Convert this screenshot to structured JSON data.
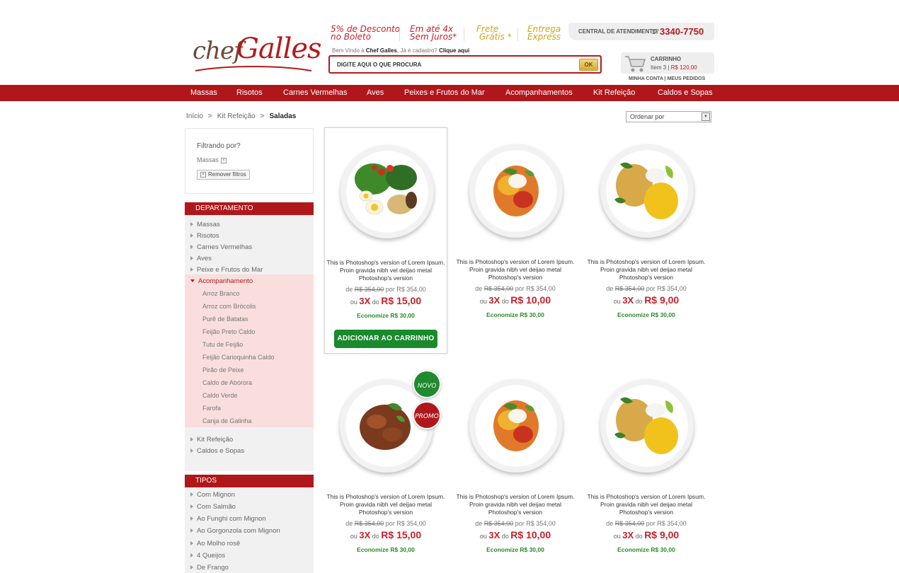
{
  "brand": {
    "chef": "chef",
    "galles": "Galles"
  },
  "promos": [
    {
      "l1": "5% de Desconto",
      "l2": "no Boleto"
    },
    {
      "l1": "Em até 4x",
      "l2": "Sem Juros*"
    },
    {
      "l1": "Frete",
      "l2": "Grátis *"
    },
    {
      "l1": "Entrega",
      "l2": "Express"
    }
  ],
  "atendimento": {
    "label": "CENTRAL DE ATENDIMENTO",
    "ddd": "27",
    "phone": "3340-7750"
  },
  "welcome": {
    "text": "Bem Vindo à ",
    "brand": "Chef Galles",
    "mid": ", Já é cadastro? ",
    "link": "Clique aqui"
  },
  "search": {
    "placeholder": "DIGITE AQUI O QUE PROCURA",
    "button": "OK"
  },
  "cart": {
    "label": "CARRINHO",
    "items": "Item 3",
    "sep": " | ",
    "total": "R$ 120,00"
  },
  "account": {
    "minha_conta": "MINHA CONTA",
    "sep": " | ",
    "meus_pedidos": "MEUS PEDIDOS"
  },
  "nav": [
    "Massas",
    "Risotos",
    "Carnes Vermelhas",
    "Aves",
    "Peixes e Frutos do Mar",
    "Acompanhamentos",
    "Kit Refeição",
    "Caldos e Sopas"
  ],
  "breadcrumb": {
    "home": "Início",
    "sep": ">",
    "parent": "Kit Refeição",
    "current": "Saladas"
  },
  "sort": {
    "selected": "Ordenar por"
  },
  "filter": {
    "title": "Filtrando por?",
    "tag": "Massas",
    "remove": "Remover filtros"
  },
  "departamento": {
    "title": "DEPARTAMENTO",
    "items_top": [
      "Massas",
      "Risotos",
      "Carnes Vermelhas",
      "Aves",
      "Peixe e Frutos do Mar"
    ],
    "active": "Acompanhamento",
    "sub": [
      "Arroz Branco",
      "Arroz com Brócolis",
      "Purê de Batatas",
      "Feijão Preto Caldo",
      "Tutu de Feijão",
      "Feijão Carioquinha Caldo",
      "Pirão de Peixe",
      "Caldo de Abórora",
      "Caldo Verde",
      "Farofa",
      "Canja de Galinha"
    ],
    "items_bottom": [
      "Kit Refeição",
      "Caldos e Sopas"
    ]
  },
  "tipos": {
    "title": "TIPOS",
    "items": [
      "Com Mignon",
      "Com Salmão",
      "Ao Funghi com Mignon",
      "Ao Gorgonzola com Mignon",
      "Ao Molho rosê",
      "4 Queijos",
      "De Frango"
    ]
  },
  "products": [
    {
      "title": "This is Photoshop's version  of Lorem Ipsum. Proin gravida nibh vel deijao metal Photoshop's version",
      "de": "de ",
      "old": "R$ 354,00",
      "por": " por R$ 354,00",
      "ou": "ou ",
      "x": "3X",
      "do": " do ",
      "amount": "R$ 15,00",
      "save": "Economize R$ 30,00"
    },
    {
      "title": "This is Photoshop's version  of Lorem Ipsum. Proin gravida nibh vel deijao metal Photoshop's version",
      "de": "de ",
      "old": "R$ 354,00",
      "por": " por R$ 354,00",
      "ou": "ou ",
      "x": "3X",
      "do": " do ",
      "amount": "R$ 10,00",
      "save": "Economize R$ 30,00"
    },
    {
      "title": "This is Photoshop's version  of Lorem Ipsum. Proin gravida nibh vel deijao metal Photoshop's version",
      "de": "de ",
      "old": "R$ 354,00",
      "por": " por R$ 354,00",
      "ou": "ou ",
      "x": "3X",
      "do": " do ",
      "amount": "R$ 9,00",
      "save": "Economize R$ 30,00"
    },
    {
      "title": "This is Photoshop's version  of Lorem Ipsum. Proin gravida nibh vel deijao metal Photoshop's version",
      "de": "de ",
      "old": "R$ 354,00",
      "por": " por R$ 354,00",
      "ou": "ou ",
      "x": "3X",
      "do": " do ",
      "amount": "R$ 15,00",
      "save": "Economize R$ 30,00"
    },
    {
      "title": "This is Photoshop's version  of Lorem Ipsum. Proin gravida nibh vel deijao metal Photoshop's version",
      "de": "de ",
      "old": "R$ 354,00",
      "por": " por R$ 354,00",
      "ou": "ou ",
      "x": "3X",
      "do": " do ",
      "amount": "R$ 10,00",
      "save": "Economize R$ 30,00"
    },
    {
      "title": "This is Photoshop's version  of Lorem Ipsum. Proin gravida nibh vel deijao metal Photoshop's version",
      "de": "de ",
      "old": "R$ 354,00",
      "por": " por R$ 354,00",
      "ou": "ou ",
      "x": "3X",
      "do": " do ",
      "amount": "R$ 9,00",
      "save": "Economize R$ 30,00"
    }
  ],
  "add_to_cart": "ADICIONAR  AO CARRINHO",
  "badges": {
    "novo": "NOVO",
    "promo": "PROMO"
  },
  "colors": {
    "brand_red": "#b0171b",
    "green": "#1a8a2c",
    "gold": "#d3a21a"
  }
}
